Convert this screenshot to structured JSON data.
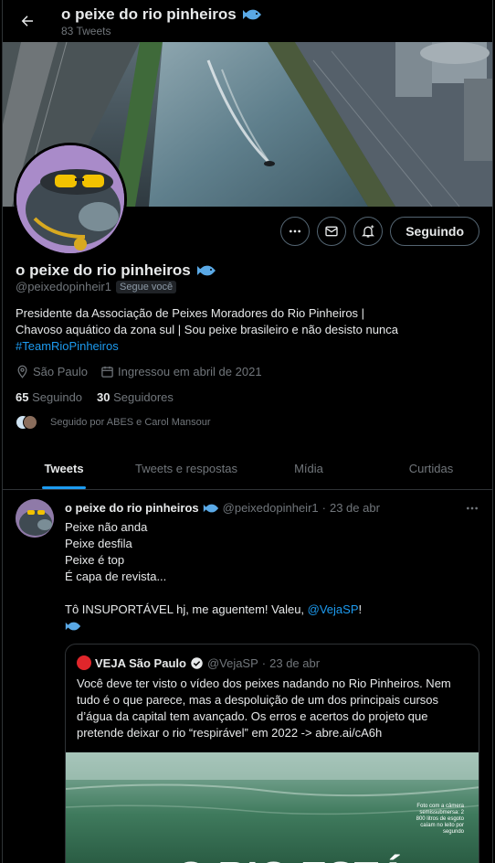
{
  "header": {
    "title": "o peixe do rio pinheiros",
    "tweet_count": "83 Tweets"
  },
  "profile": {
    "name": "o peixe do rio pinheiros",
    "handle": "@peixedopinheir1",
    "follows_you": "Segue você",
    "bio_line1": "Presidente da Associação de Peixes Moradores do Rio Pinheiros |",
    "bio_line2": "Chavoso aquático da zona sul | Sou peixe brasileiro e não desisto nunca",
    "bio_hashtag": "#TeamRioPinheiros",
    "location": "São Paulo",
    "joined": "Ingressou em abril de 2021",
    "following_count": "65",
    "following_label": "Seguindo",
    "followers_count": "30",
    "followers_label": "Seguidores",
    "followed_by": "Seguido por ABES e Carol Mansour",
    "follow_button": "Seguindo"
  },
  "tabs": [
    "Tweets",
    "Tweets e respostas",
    "Mídia",
    "Curtidas"
  ],
  "tweet": {
    "author": "o peixe do rio pinheiros",
    "handle": "@peixedopinheir1",
    "dot": "·",
    "date": "23 de abr",
    "line1": "Peixe não anda",
    "line2": "Peixe desfila",
    "line3": "Peixe é top",
    "line4": "É capa de revista...",
    "line5_text": "Tô INSUPORTÁVEL hj, me aguentem! Valeu, ",
    "line5_mention": "@VejaSP",
    "line5_end": "!"
  },
  "quote": {
    "author": "VEJA São Paulo",
    "handle": "@VejaSP",
    "dot": "·",
    "date": "23 de abr",
    "text": "Você deve ter visto o vídeo dos peixes nadando no Rio Pinheiros. Nem tudo é o que parece, mas a despoluição de um dos principais cursos d’água da capital tem avançado. Os erros e acertos do projeto que pretende deixar o rio “respirável” em 2022 -> abre.ai/cA6h",
    "media_caption": "Foto com a câmera semissubmersa: 2 800 litros de esgoto caíam no leito por segundo",
    "media_headline": "O RIO ESTÁ"
  },
  "colors": {
    "accent": "#1d9bf0",
    "background": "#000000",
    "muted": "#71767b",
    "text": "#e7e9ea"
  }
}
